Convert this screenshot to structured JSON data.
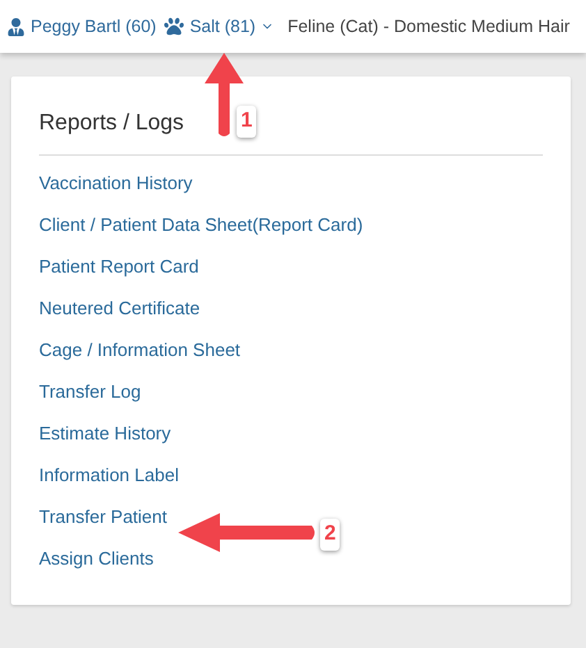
{
  "header": {
    "client": {
      "name": "Peggy Bartl (60)"
    },
    "patient": {
      "name": "Salt (81)"
    },
    "species": "Feline (Cat) - Domestic Medium Hair"
  },
  "panel": {
    "title": "Reports / Logs",
    "items": [
      {
        "label": "Vaccination History"
      },
      {
        "label": "Client / Patient Data Sheet(Report Card)"
      },
      {
        "label": "Patient Report Card"
      },
      {
        "label": "Neutered Certificate"
      },
      {
        "label": "Cage / Information Sheet"
      },
      {
        "label": "Transfer Log"
      },
      {
        "label": "Estimate History"
      },
      {
        "label": "Information Label"
      },
      {
        "label": "Transfer Patient"
      },
      {
        "label": "Assign Clients"
      }
    ]
  },
  "annotations": [
    {
      "label": "1",
      "kind": "up"
    },
    {
      "label": "2",
      "kind": "left"
    }
  ]
}
